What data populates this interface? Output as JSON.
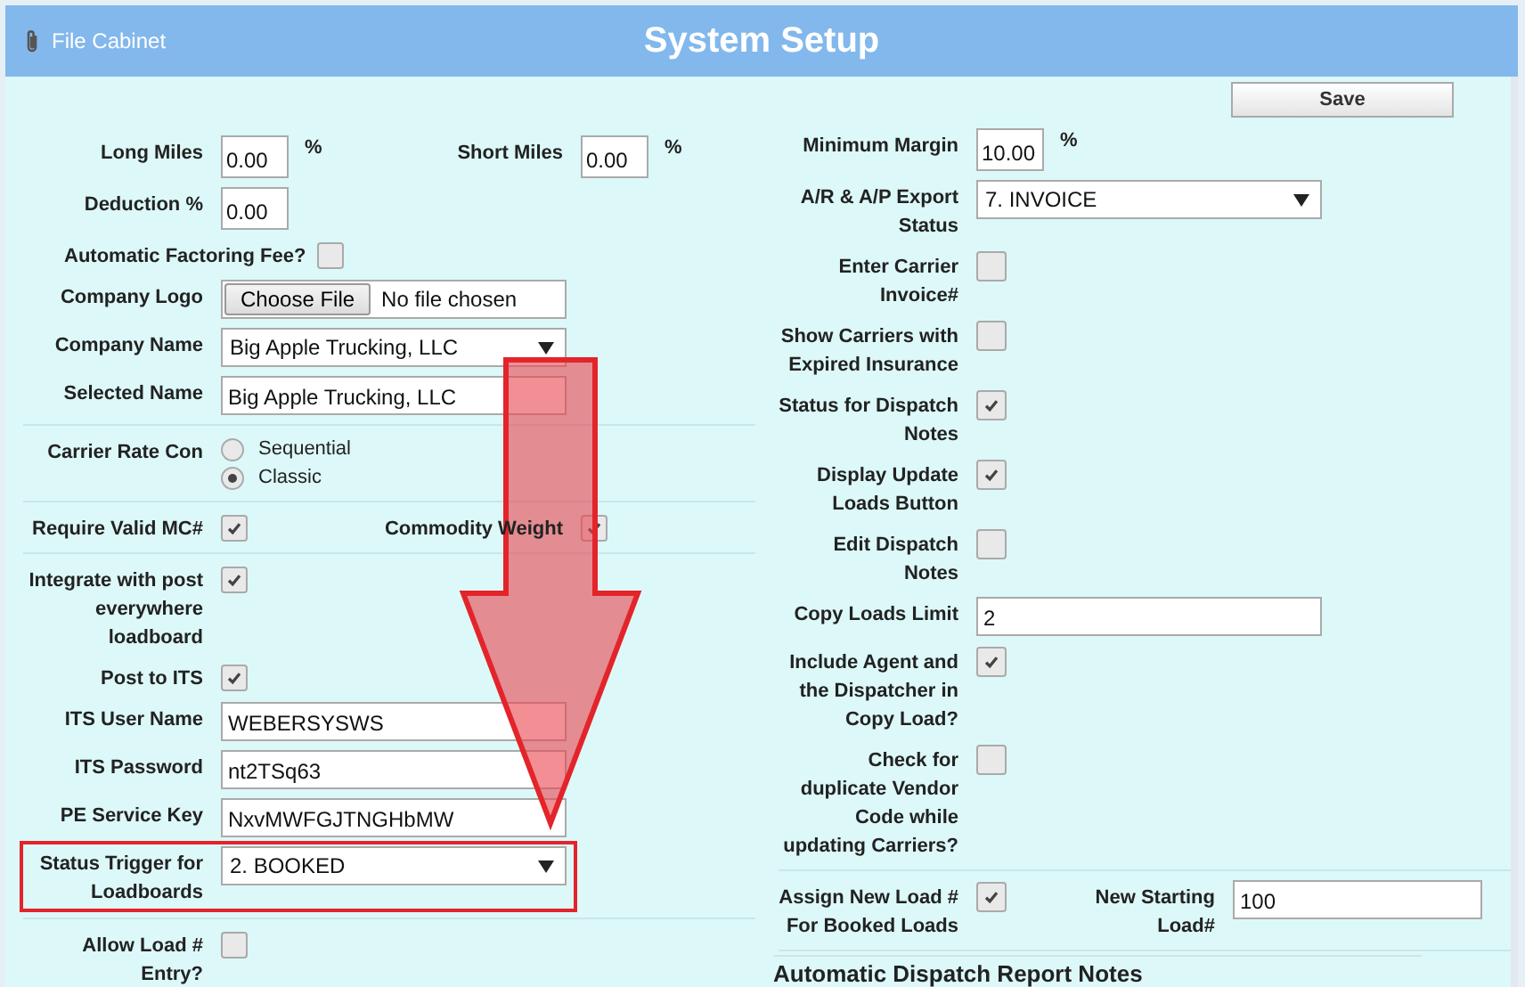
{
  "header": {
    "link": "File Cabinet",
    "title": "System Setup"
  },
  "save_button": "Save",
  "left_rows": [
    {
      "kind": "pair",
      "items": [
        {
          "kind": "amount",
          "label": "Long Miles",
          "value": "0.00",
          "suffix": "%"
        },
        {
          "kind": "amount",
          "label": "Short Miles",
          "value": "0.00",
          "suffix": "%"
        }
      ]
    },
    {
      "kind": "amount",
      "label": "Deduction %",
      "value": "0.00"
    },
    {
      "kind": "checkbox-wide",
      "label": "Automatic Factoring Fee?",
      "checked": false
    },
    {
      "kind": "file",
      "label": "Company Logo",
      "button": "Choose File",
      "status": "No file chosen"
    },
    {
      "kind": "select",
      "label": "Company Name",
      "value": "Big Apple Trucking, LLC",
      "highlighted": false
    },
    {
      "kind": "text",
      "label": "Selected Name",
      "value": "Big Apple Trucking, LLC"
    },
    {
      "kind": "divider"
    },
    {
      "kind": "radio",
      "label": "Carrier Rate Con",
      "options": [
        {
          "label": "Sequential",
          "selected": false
        },
        {
          "label": "Classic",
          "selected": true
        }
      ]
    },
    {
      "kind": "divider"
    },
    {
      "kind": "pair",
      "items": [
        {
          "kind": "checkbox",
          "label": "Require Valid MC#",
          "checked": true
        },
        {
          "kind": "checkbox",
          "label": "Commodity Weight",
          "checked": true
        }
      ]
    },
    {
      "kind": "divider"
    },
    {
      "kind": "checkbox",
      "label": "Integrate with post everywhere loadboard",
      "checked": true
    },
    {
      "kind": "checkbox",
      "label": "Post to ITS",
      "checked": true
    },
    {
      "kind": "text",
      "label": "ITS User Name",
      "value": "WEBERSYSWS"
    },
    {
      "kind": "text",
      "label": "ITS Password",
      "value": "nt2TSq63"
    },
    {
      "kind": "text",
      "label": "PE Service Key",
      "value": "NxvMWFGJTNGHbMW"
    },
    {
      "kind": "select",
      "label": "Status Trigger for Loadboards",
      "value": "2. BOOKED",
      "highlighted": true
    },
    {
      "kind": "divider"
    },
    {
      "kind": "checkbox",
      "label": "Allow Load # Entry?",
      "checked": false
    }
  ],
  "right_rows": [
    {
      "kind": "amount",
      "label": "Minimum Margin",
      "value": "10.00",
      "suffix": "%"
    },
    {
      "kind": "select",
      "label": "A/R & A/P Export Status",
      "value": "7. INVOICE",
      "highlighted": false
    },
    {
      "kind": "checkbox",
      "label": "Enter Carrier Invoice#",
      "checked": false
    },
    {
      "kind": "checkbox",
      "label": "Show Carriers with Expired Insurance",
      "checked": false
    },
    {
      "kind": "checkbox",
      "label": "Status for Dispatch Notes",
      "checked": true
    },
    {
      "kind": "checkbox",
      "label": "Display Update Loads Button",
      "checked": true
    },
    {
      "kind": "checkbox",
      "label": "Edit Dispatch Notes",
      "checked": false
    },
    {
      "kind": "text",
      "label": "Copy Loads Limit",
      "value": "2"
    },
    {
      "kind": "checkbox",
      "label": "Include Agent and the Dispatcher in Copy Load?",
      "checked": true
    },
    {
      "kind": "checkbox",
      "label": "Check for duplicate Vendor Code while updating Carriers?",
      "checked": false
    },
    {
      "kind": "divider"
    },
    {
      "kind": "pair",
      "items": [
        {
          "kind": "checkbox",
          "label": "Assign New Load # For Booked Loads",
          "checked": true
        },
        {
          "kind": "text",
          "label": "New Starting Load#",
          "value": "100"
        }
      ]
    },
    {
      "kind": "divider"
    }
  ],
  "section_heading": "Automatic Dispatch Report Notes",
  "pointer_arrow": true
}
